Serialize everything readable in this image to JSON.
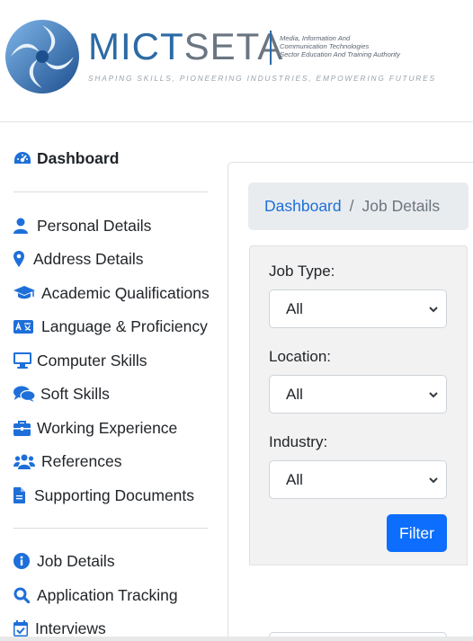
{
  "header": {
    "brand_part1": "MICT",
    "brand_part2": "SETA",
    "subtitle_lines": [
      "Media, Information And",
      "Communication Technologies",
      "Sector Education And Training Authority"
    ],
    "tagline": "SHAPING SKILLS, PIONEERING INDUSTRIES, EMPOWERING FUTURES",
    "colors": {
      "brand_blue": "#2c6aa5",
      "brand_grey": "#6b7582"
    }
  },
  "sidebar": {
    "dashboard": {
      "label": "Dashboard",
      "icon": "speedometer-icon"
    },
    "profile_items": [
      {
        "label": "Personal Details",
        "icon": "user-icon"
      },
      {
        "label": "Address Details",
        "icon": "map-pin-icon"
      },
      {
        "label": "Academic Qualifications",
        "icon": "graduation-cap-icon"
      },
      {
        "label": "Language & Proficiency",
        "icon": "language-icon"
      },
      {
        "label": "Computer Skills",
        "icon": "desktop-icon"
      },
      {
        "label": "Soft Skills",
        "icon": "comments-icon"
      },
      {
        "label": "Working Experience",
        "icon": "briefcase-icon"
      },
      {
        "label": "References",
        "icon": "users-icon"
      },
      {
        "label": "Supporting Documents",
        "icon": "document-icon"
      }
    ],
    "job_items": [
      {
        "label": "Job Details",
        "icon": "info-circle-icon"
      },
      {
        "label": "Application Tracking",
        "icon": "search-icon"
      },
      {
        "label": "Interviews",
        "icon": "calendar-check-icon"
      }
    ],
    "icon_color": "#1e6fd9"
  },
  "breadcrumb": {
    "link": "Dashboard",
    "separator": "/",
    "current": "Job Details"
  },
  "filters": {
    "job_type": {
      "label": "Job Type:",
      "value": "All"
    },
    "location": {
      "label": "Location:",
      "value": "All"
    },
    "industry": {
      "label": "Industry:",
      "value": "All"
    },
    "button_label": "Filter",
    "button_color": "#0d6efd"
  }
}
